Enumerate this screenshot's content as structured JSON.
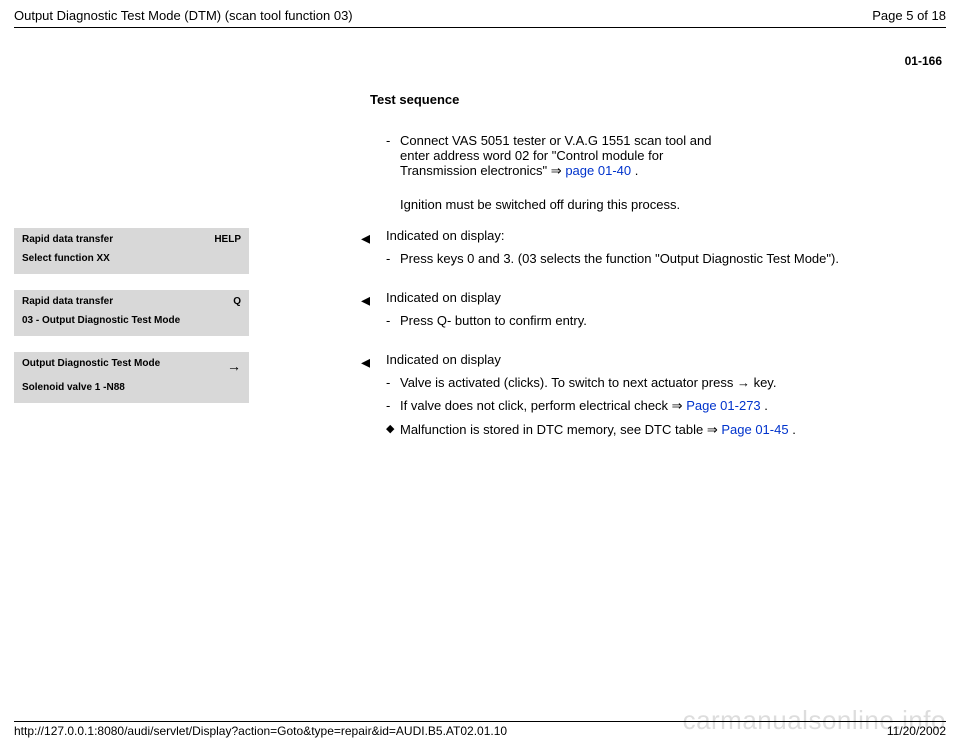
{
  "header": {
    "title": "Output Diagnostic Test Mode (DTM) (scan tool function 03)",
    "page_label": "Page 5 of 18"
  },
  "corner_number": "01-166",
  "section_heading": "Test sequence",
  "intro": {
    "bullet_mark": "-",
    "text_before_link": "Connect VAS 5051 tester or V.A.G 1551 scan tool and enter address word 02 for \"Control module for Transmission electronics\"  ",
    "arrow": "⇒",
    "link_text": "page 01-40",
    "text_after_link": " .",
    "note": "Ignition must be switched off during this process."
  },
  "rows": [
    {
      "panel": {
        "line1_left": "Rapid data transfer",
        "line1_right": "HELP",
        "line2": "Select function XX"
      },
      "arrow": "◂",
      "title": "Indicated on display:",
      "items": [
        {
          "mark": "-",
          "text": "Press keys 0 and 3. (03 selects the function \"Output Diagnostic Test Mode\")."
        }
      ]
    },
    {
      "panel": {
        "line1_left": "Rapid data transfer",
        "line1_right": "Q",
        "line2": "03 - Output Diagnostic Test Mode"
      },
      "arrow": "◂",
      "title": "Indicated on display",
      "items": [
        {
          "mark": "-",
          "text": "Press Q- button to confirm entry."
        }
      ]
    },
    {
      "panel": {
        "line1_left": "Output Diagnostic Test Mode",
        "line1_right": "→",
        "line2": "Solenoid valve 1 -N88"
      },
      "arrow": "◂",
      "title": "Indicated on display",
      "items": [
        {
          "mark": "-",
          "text": "Valve is activated (clicks). To switch to next actuator press ",
          "after_glyph": "→",
          "tail": " key."
        },
        {
          "mark": "-",
          "text": "If valve does not click, perform electrical check  ",
          "arrow": "⇒",
          "link": "Page 01-273",
          "tail": " ."
        },
        {
          "mark": "◆",
          "text": "Malfunction is stored in DTC memory, see DTC table  ",
          "arrow": "⇒",
          "link": "Page 01-45",
          "tail": " ."
        }
      ]
    }
  ],
  "footer": {
    "url": "http://127.0.0.1:8080/audi/servlet/Display?action=Goto&type=repair&id=AUDI.B5.AT02.01.10",
    "date": "11/20/2002"
  },
  "watermark": "carmanualsonline.info"
}
